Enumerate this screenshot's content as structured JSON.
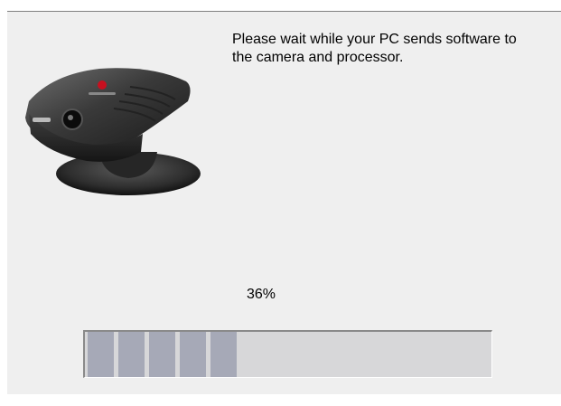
{
  "dialog": {
    "message": "Please wait while your PC sends software to the camera and processor.",
    "progress": {
      "percent_text": "36%",
      "fraction": 0.36,
      "filled_blocks": 5,
      "block_color": "#a6a9b7",
      "track_color": "#d7d7d9"
    },
    "image": {
      "icon": "camera-icon",
      "logo_color": "#c8101f"
    }
  }
}
